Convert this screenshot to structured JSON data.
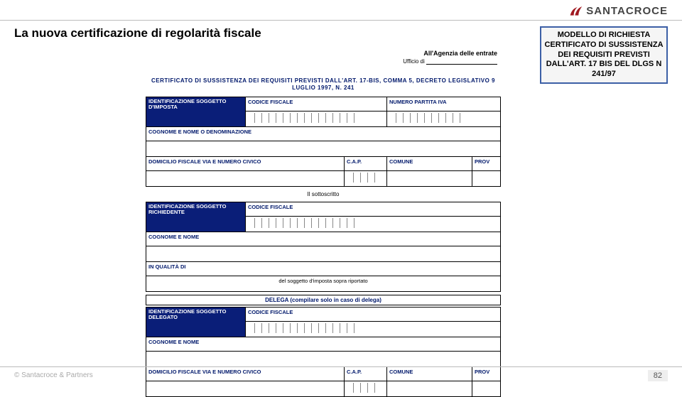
{
  "brand": {
    "name": "SANTACROCE"
  },
  "title": "La nuova certificazione di regolarità fiscale",
  "callout": "MODELLO DI RICHIESTA CERTIFICATO DI SUSSISTENZA DEI REQUISITI PREVISTI DALL'ART. 17 BIS DEL DLGS N 241/97",
  "form": {
    "agenzia": "All'Agenzia delle entrate",
    "ufficio_prefix": "Ufficio di",
    "cert_heading": "CERTIFICATO DI SUSSISTENZA DEI REQUISITI PREVISTI DALL'ART. 17-BIS, COMMA 5, DECRETO LEGISLATIVO 9 LUGLIO 1997, N. 241",
    "block1": {
      "id_label": "IDENTIFICAZIONE SOGGETTO D'IMPOSTA",
      "cf": "CODICE FISCALE",
      "piva": "NUMERO PARTITA IVA",
      "nome": "COGNOME E NOME O DENOMINAZIONE",
      "dom": "DOMICILIO FISCALE VIA E NUMERO CIVICO",
      "cap": "C.A.P.",
      "comune": "COMUNE",
      "prov": "PROV"
    },
    "sottoscritto": "Il sottoscritto",
    "block2": {
      "id_label": "IDENTIFICAZIONE SOGGETTO RICHIEDENTE",
      "cf": "CODICE FISCALE",
      "nome": "COGNOME E NOME",
      "qualita": "IN QUALITÀ DI",
      "qualita_suffix": "del soggetto d'imposta sopra riportato"
    },
    "delega_heading": "DELEGA (compilare solo in caso di delega)",
    "block3": {
      "id_label": "IDENTIFICAZIONE SOGGETTO DELEGATO",
      "cf": "CODICE FISCALE",
      "nome": "COGNOME E NOME",
      "dom": "DOMICILIO FISCALE VIA E NUMERO CIVICO",
      "cap": "C.A.P.",
      "comune": "COMUNE",
      "prov": "PROV"
    }
  },
  "footer": {
    "copyright": "© Santacroce & Partners",
    "page": "82"
  }
}
